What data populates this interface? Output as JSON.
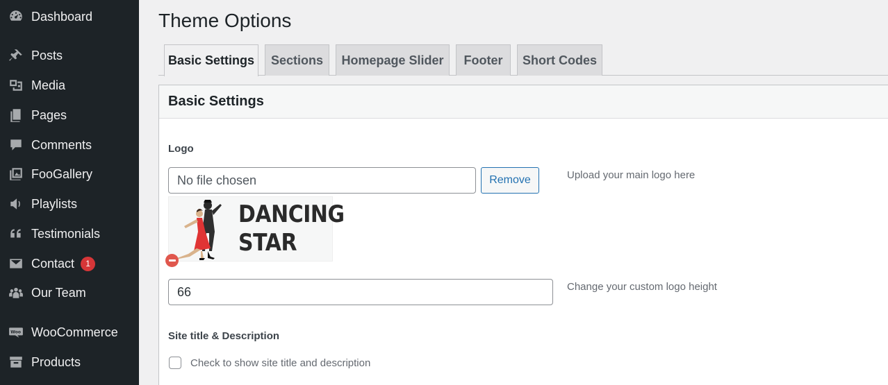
{
  "sidebar": {
    "items": [
      {
        "label": "Dashboard",
        "icon": "dashboard-icon"
      },
      {
        "label": "Posts",
        "icon": "pin-icon"
      },
      {
        "label": "Media",
        "icon": "media-icon"
      },
      {
        "label": "Pages",
        "icon": "pages-icon"
      },
      {
        "label": "Comments",
        "icon": "comment-icon"
      },
      {
        "label": "FooGallery",
        "icon": "gallery-icon"
      },
      {
        "label": "Playlists",
        "icon": "speaker-icon"
      },
      {
        "label": "Testimonials",
        "icon": "quote-icon"
      },
      {
        "label": "Contact",
        "icon": "mail-icon",
        "badge": "1"
      },
      {
        "label": "Our Team",
        "icon": "team-icon"
      },
      {
        "label": "WooCommerce",
        "icon": "woo-icon"
      },
      {
        "label": "Products",
        "icon": "archive-icon"
      }
    ]
  },
  "header": {
    "title": "Theme Options"
  },
  "tabs": [
    "Basic Settings",
    "Sections",
    "Homepage Slider",
    "Footer",
    "Short Codes"
  ],
  "panel": {
    "title": "Basic Settings",
    "logo": {
      "label": "Logo",
      "file_value": "No file chosen",
      "remove_label": "Remove",
      "hint": "Upload your main logo here",
      "image_text_line1": "DANCING",
      "image_text_line2": "STAR"
    },
    "logo_height": {
      "value": "66",
      "hint": "Change your custom logo height"
    },
    "site_title": {
      "label": "Site title & Description",
      "checkbox_label": "Check to show site title and description",
      "checked": false
    }
  },
  "colors": {
    "sidebar_bg": "#1d2327",
    "accent": "#2271b1",
    "badge": "#d63638"
  }
}
